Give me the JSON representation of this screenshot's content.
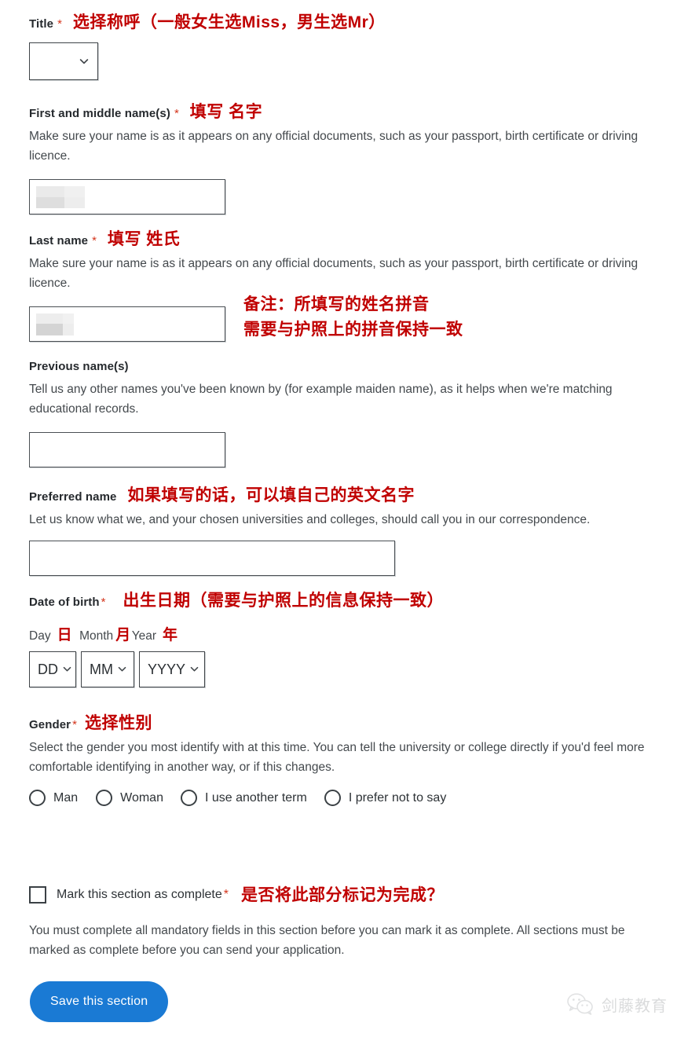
{
  "form": {
    "title_field": {
      "label": "Title",
      "required_mark": "*",
      "annotation_cn": "选择称呼（一般女生选Miss，男生选Mr）",
      "select_value": "",
      "icon": "chevron-down-icon"
    },
    "first_name": {
      "label": "First and middle name(s)",
      "required_mark": "*",
      "annotation_cn": "填写 名字",
      "hint": "Make sure your name is as it appears on any official documents, such as your passport, birth certificate or driving licence.",
      "value": "",
      "redacted": true
    },
    "last_name": {
      "label": "Last name",
      "required_mark": "*",
      "annotation_cn": "填写 姓氏",
      "hint": "Make sure your name is as it appears on any official documents, such as your passport, birth certificate or driving licence.",
      "value": "",
      "redacted": true,
      "side_note_line1": "备注：所填写的姓名拼音",
      "side_note_line2": "需要与护照上的拼音保持一致"
    },
    "previous_names": {
      "label": "Previous name(s)",
      "hint": "Tell us any other names you've been known by (for example maiden name), as it helps when we're matching educational records.",
      "value": ""
    },
    "preferred_name": {
      "label": "Preferred name",
      "annotation_cn": "如果填写的话，可以填自己的英文名字",
      "hint": "Let us know what we, and your chosen universities and colleges, should call you in our correspondence.",
      "value": ""
    },
    "date_of_birth": {
      "label": "Date of birth",
      "required_mark": "*",
      "annotation_cn": "出生日期（需要与护照上的信息保持一致）",
      "sub_labels": [
        {
          "en": "Day",
          "cn": "日"
        },
        {
          "en": "Month",
          "cn": "月"
        },
        {
          "en": "Year",
          "cn": "年"
        }
      ],
      "day_value": "DD",
      "month_value": "MM",
      "year_value": "YYYY"
    },
    "gender": {
      "label": "Gender",
      "required_mark": "*",
      "annotation_cn": "选择性别",
      "hint": "Select the gender you most identify with at this time. You can tell the university or college directly if you'd feel more comfortable identifying in another way, or if this changes.",
      "options": [
        {
          "label": "Man",
          "selected": false
        },
        {
          "label": "Woman",
          "selected": false
        },
        {
          "label": "I use another term",
          "selected": false
        },
        {
          "label": "I prefer not to say",
          "selected": false
        }
      ]
    },
    "mark_complete": {
      "label": "Mark this section as complete",
      "required_mark": "*",
      "annotation_cn": "是否将此部分标记为完成？",
      "checked": false,
      "hint": "You must complete all mandatory fields in this section before you can mark it as complete. All sections must be marked as complete before you can send your application."
    },
    "save_button": {
      "label": "Save this section"
    }
  },
  "watermark": {
    "text": "剑藤教育",
    "icon": "wechat-icon"
  },
  "colors": {
    "annotation_red": "#c00000",
    "required_red": "#d4351c",
    "button_blue": "#1a7ad4",
    "text_dark": "#25292d",
    "hint_gray": "#44494d"
  }
}
